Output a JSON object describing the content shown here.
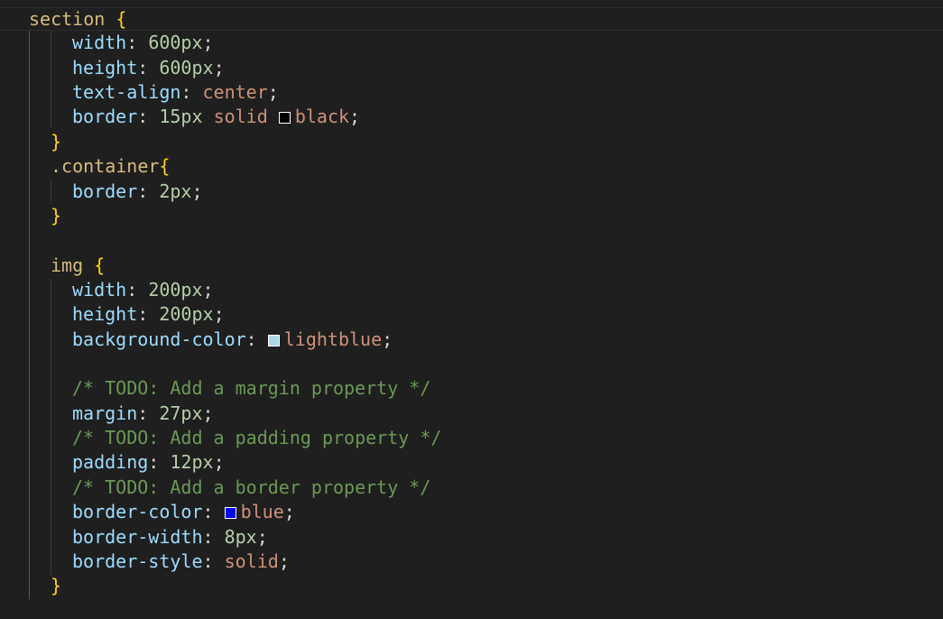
{
  "lines": {
    "l1": {
      "selector": "section",
      "brace": "{"
    },
    "l2": {
      "prop": "width",
      "value": "600px"
    },
    "l3": {
      "prop": "height",
      "value": "600px"
    },
    "l4": {
      "prop": "text-align",
      "value": "center"
    },
    "l5": {
      "prop": "border",
      "num": "15px",
      "kw": "solid",
      "color": "black"
    },
    "l6": {
      "brace": "}"
    },
    "l7": {
      "selector": ".container",
      "brace": "{"
    },
    "l8": {
      "prop": "border",
      "value": "2px"
    },
    "l9": {
      "brace": "}"
    },
    "l11": {
      "selector": "img",
      "brace": "{"
    },
    "l12": {
      "prop": "width",
      "value": "200px"
    },
    "l13": {
      "prop": "height",
      "value": "200px"
    },
    "l14": {
      "prop": "background-color",
      "color": "lightblue"
    },
    "l16": {
      "comment": "/* TODO: Add a margin property */"
    },
    "l17": {
      "prop": "margin",
      "value": "27px"
    },
    "l18": {
      "comment": "/* TODO: Add a padding property */"
    },
    "l19": {
      "prop": "padding",
      "value": "12px"
    },
    "l20": {
      "comment": "/* TODO: Add a border property */"
    },
    "l21": {
      "prop": "border-color",
      "color": "blue"
    },
    "l22": {
      "prop": "border-width",
      "value": "8px"
    },
    "l23": {
      "prop": "border-style",
      "value": "solid"
    },
    "l24": {
      "brace": "}"
    }
  },
  "syntax": {
    ":": ":",
    ";": ";"
  },
  "theme": {
    "background": "#1f1f1f",
    "property": "#9cdcfe",
    "number": "#b5cea8",
    "keyword": "#ce9178",
    "comment": "#6a9955",
    "brace": "#ffd700",
    "selector": "#d7ba7d"
  }
}
